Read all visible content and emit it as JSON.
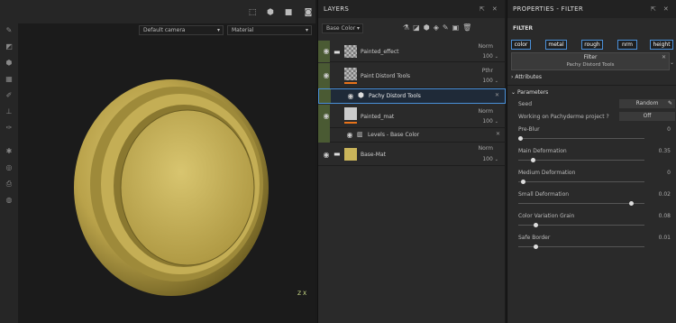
{
  "viewport": {
    "camera_select": "Default camera",
    "material_select": "Material",
    "axis_gizmo": "Z X"
  },
  "layers": {
    "title": "LAYERS",
    "channel_select": "Base Color",
    "rows": [
      {
        "name": "Painted_effect",
        "mode": "Norm",
        "value": "100"
      },
      {
        "name": "Paint Distord Tools",
        "mode": "Pthr",
        "value": "100"
      },
      {
        "name": "Pachy Distord Tools"
      },
      {
        "name": "Painted_mat",
        "mode": "Norm",
        "value": "100"
      },
      {
        "name": "Levels - Base Color"
      },
      {
        "name": "Base-Mat",
        "mode": "Norm",
        "value": "100"
      }
    ]
  },
  "properties": {
    "title": "PROPERTIES - FILTER",
    "section": "FILTER",
    "channels": [
      "color",
      "metal",
      "rough",
      "nrm",
      "height"
    ],
    "filter_label": "Filter",
    "filter_name": "Pachy Distord Tools",
    "attributes_label": "Attributes",
    "parameters_label": "Parameters",
    "seed_label": "Seed",
    "seed_value": "Random",
    "pachy_label": "Working on Pachyderme project ?",
    "pachy_value": "Off",
    "sliders": [
      {
        "label": "Pre-Blur",
        "value": "0",
        "fraction": 0.0
      },
      {
        "label": "Main Deformation",
        "value": "0.35",
        "fraction": 0.1
      },
      {
        "label": "Medium Deformation",
        "value": "0",
        "fraction": 0.02
      },
      {
        "label": "Small Deformation",
        "value": "0.02",
        "fraction": 0.88
      },
      {
        "label": "Color Variation Grain",
        "value": "0.08",
        "fraction": 0.12
      },
      {
        "label": "Safe Border",
        "value": "0.01",
        "fraction": 0.12
      }
    ]
  },
  "colors": {
    "accent": "#4a90d9",
    "layer_mask": "#4a5a33",
    "orange_bar": "#e8731a",
    "material": "#c9b45a"
  }
}
